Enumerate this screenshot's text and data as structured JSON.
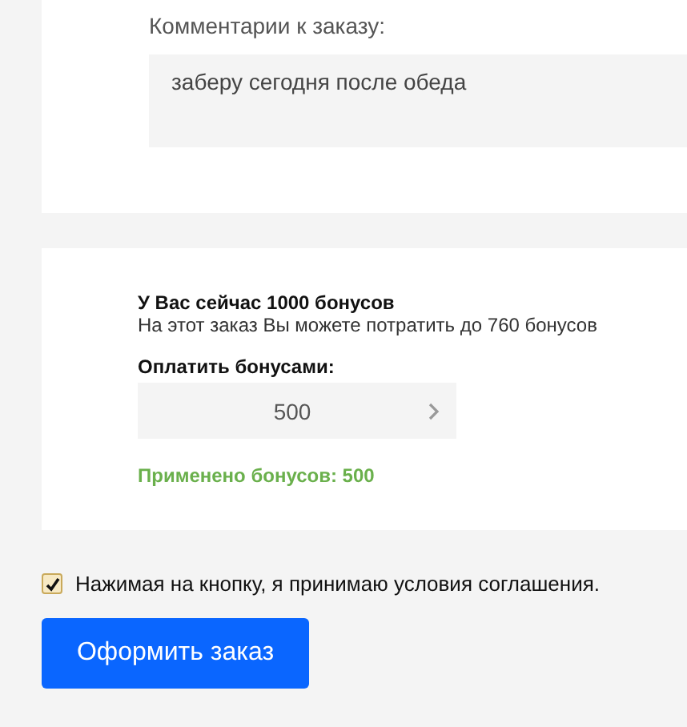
{
  "comment": {
    "label": "Комментарии к заказу:",
    "value": "заберу сегодня после обеда"
  },
  "bonuses": {
    "balance": "У Вас сейчас 1000 бонусов",
    "limit": "На этот заказ Вы можете потратить до 760 бонусов",
    "pay_label": "Оплатить бонусами:",
    "pay_value": "500",
    "applied": "Применено бонусов: 500"
  },
  "agreement": {
    "label": "Нажимая на кнопку, я принимаю условия соглашения.",
    "checked": true
  },
  "submit_button": "Оформить заказ"
}
